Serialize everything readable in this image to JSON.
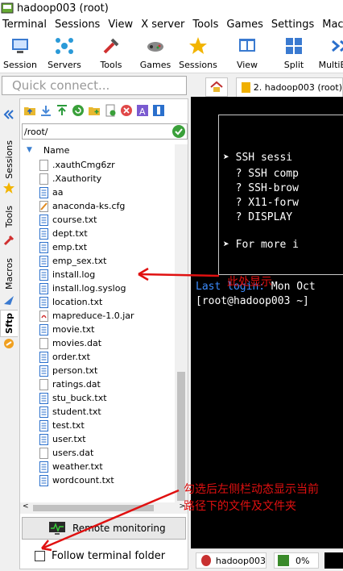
{
  "window": {
    "title": "hadoop003 (root)"
  },
  "menu": [
    "Terminal",
    "Sessions",
    "View",
    "X server",
    "Tools",
    "Games",
    "Settings",
    "Macros"
  ],
  "toolbar": [
    {
      "label": "Session",
      "icon": "session-icon"
    },
    {
      "label": "Servers",
      "icon": "servers-icon"
    },
    {
      "label": "Tools",
      "icon": "tools-icon"
    },
    {
      "label": "Games",
      "icon": "games-icon"
    },
    {
      "label": "Sessions",
      "icon": "sessions-star-icon"
    },
    {
      "label": "View",
      "icon": "view-icon"
    },
    {
      "label": "Split",
      "icon": "split-icon"
    },
    {
      "label": "MultiExec",
      "icon": "multiexec-icon"
    }
  ],
  "quick_connect": {
    "placeholder": "Quick connect..."
  },
  "side_tabs": [
    {
      "label": "Sessions",
      "icon": "star-icon"
    },
    {
      "label": "Tools",
      "icon": "tools-icon"
    },
    {
      "label": "Macros",
      "icon": "macro-icon"
    },
    {
      "label": "Sftp",
      "icon": "sftp-icon",
      "active": true
    }
  ],
  "sftp": {
    "path": "/root/",
    "column_name": "Name",
    "files": [
      {
        "name": ".xauthCmg6zr",
        "type": "blank"
      },
      {
        "name": ".Xauthority",
        "type": "blank"
      },
      {
        "name": "aa",
        "type": "text"
      },
      {
        "name": "anaconda-ks.cfg",
        "type": "cfg"
      },
      {
        "name": "course.txt",
        "type": "text"
      },
      {
        "name": "dept.txt",
        "type": "text"
      },
      {
        "name": "emp.txt",
        "type": "text"
      },
      {
        "name": "emp_sex.txt",
        "type": "text"
      },
      {
        "name": "install.log",
        "type": "text"
      },
      {
        "name": "install.log.syslog",
        "type": "text"
      },
      {
        "name": "location.txt",
        "type": "text"
      },
      {
        "name": "mapreduce-1.0.jar",
        "type": "jar"
      },
      {
        "name": "movie.txt",
        "type": "text"
      },
      {
        "name": "movies.dat",
        "type": "blank"
      },
      {
        "name": "order.txt",
        "type": "text"
      },
      {
        "name": "person.txt",
        "type": "text"
      },
      {
        "name": "ratings.dat",
        "type": "blank"
      },
      {
        "name": "stu_buck.txt",
        "type": "text"
      },
      {
        "name": "student.txt",
        "type": "text"
      },
      {
        "name": "test.txt",
        "type": "text"
      },
      {
        "name": "user.txt",
        "type": "text"
      },
      {
        "name": "users.dat",
        "type": "blank"
      },
      {
        "name": "weather.txt",
        "type": "text"
      },
      {
        "name": "wordcount.txt",
        "type": "text"
      }
    ],
    "remote_monitoring": "Remote monitoring",
    "follow_terminal_folder": "Follow terminal folder",
    "follow_checked": false
  },
  "tabs": {
    "session_tab": "2. hadoop003 (root)"
  },
  "terminal": {
    "lines": [
      {
        "text": "➤ SSH sessi",
        "color": "#ffffff"
      },
      {
        "text": "  ? SSH comp",
        "color": "#ffffff"
      },
      {
        "text": "  ? SSH-brow",
        "color": "#ffffff"
      },
      {
        "text": "  ? X11-forw",
        "color": "#ffffff"
      },
      {
        "text": "  ? DISPLAY",
        "color": "#ffffff"
      },
      {
        "text": "➤ For more i",
        "color": "#ffffff"
      },
      {
        "text": "Last login:",
        "color": "#3c8cff",
        "rest": " Mon Oct"
      },
      {
        "text": "[root@hadoop003 ~]",
        "color": "#ffffff"
      }
    ]
  },
  "statusbar": {
    "host": "hadoop003",
    "cpu": "0%"
  },
  "annotations": {
    "arrow1_text": "此处显示",
    "arrow2_line1": "勾选后左侧栏动态显示当前",
    "arrow2_line2": "路径下的文件及文件夹"
  },
  "colors": {
    "annotation_red": "#e01010",
    "terminal_bg": "#000000",
    "accent_blue": "#3c8cff"
  }
}
